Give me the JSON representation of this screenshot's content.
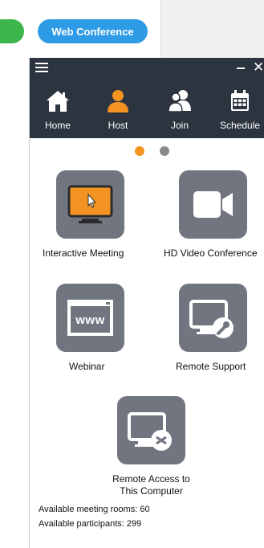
{
  "header": {
    "web_conference_label": "Web Conference"
  },
  "nav": [
    {
      "label": "Home",
      "icon": "home-icon"
    },
    {
      "label": "Host",
      "icon": "host-icon"
    },
    {
      "label": "Join",
      "icon": "join-icon"
    },
    {
      "label": "Schedule",
      "icon": "calendar-icon"
    }
  ],
  "tiles": {
    "interactive_meeting": "Interactive Meeting",
    "hd_video": "HD Video Conference",
    "webinar": "Webinar",
    "webinar_icon_text": "www",
    "remote_support": "Remote Support",
    "remote_access_line1": "Remote Access to",
    "remote_access_line2": "This Computer"
  },
  "status": {
    "rooms": "Available meeting rooms: 60",
    "participants": "Available participants: 299"
  },
  "colors": {
    "accent_orange": "#f39322",
    "tile_gray": "#707580",
    "bar_dark": "#2c3440",
    "button_blue": "#2d9be5"
  }
}
